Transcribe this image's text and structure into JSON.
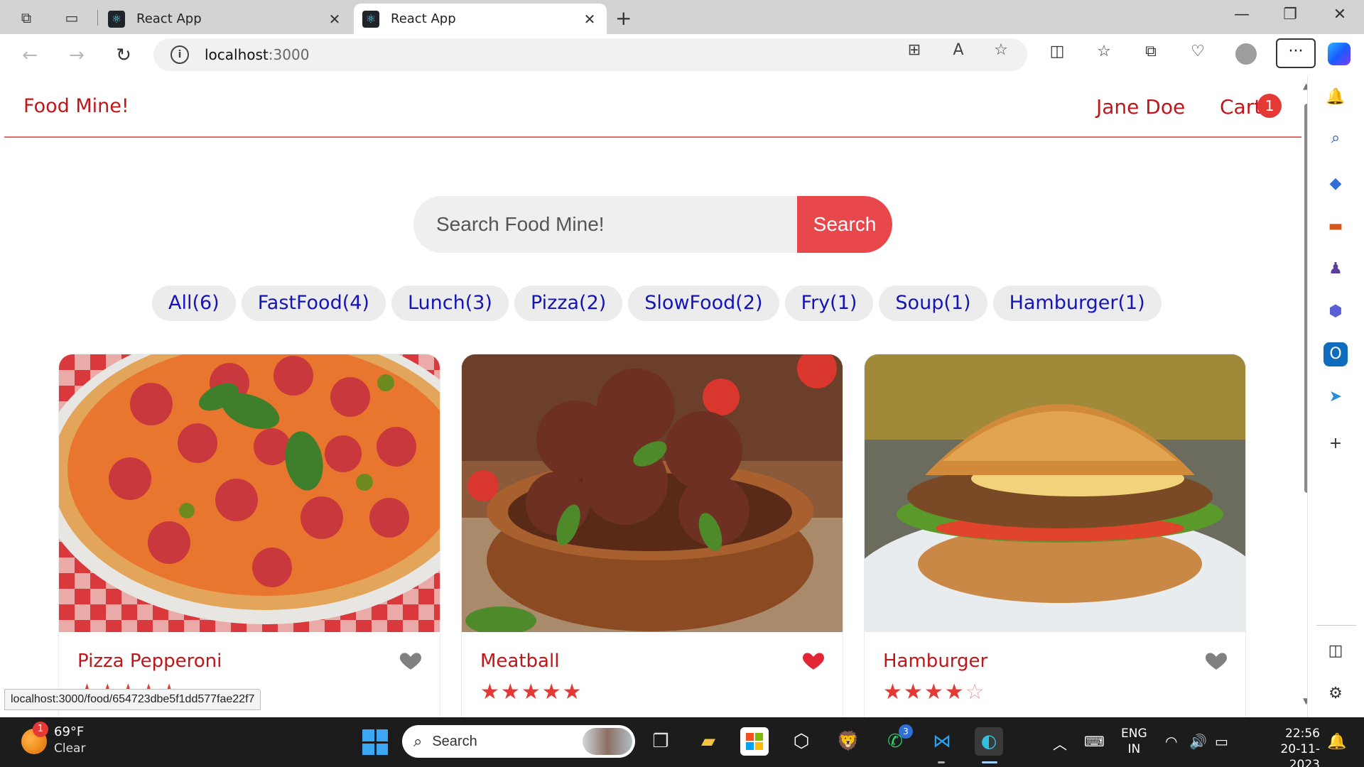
{
  "browser": {
    "tabs": [
      {
        "title": "React App",
        "active": false
      },
      {
        "title": "React App",
        "active": true
      }
    ],
    "url_host": "localhost",
    "url_port": ":3000",
    "status_url": "localhost:3000/food/654723dbe5f1dd577fae22f7"
  },
  "app": {
    "brand": "Food Mine!",
    "user_name": "Jane Doe",
    "cart_label": "Cart",
    "cart_count": "1",
    "search_placeholder": "Search Food Mine!",
    "search_button": "Search",
    "tags": [
      "All(6)",
      "FastFood(4)",
      "Lunch(3)",
      "Pizza(2)",
      "SlowFood(2)",
      "Fry(1)",
      "Soup(1)",
      "Hamburger(1)"
    ],
    "foods": [
      {
        "name": "Pizza Pepperoni",
        "favorite": false,
        "stars": 4.5
      },
      {
        "name": "Meatball",
        "favorite": true,
        "stars": 5
      },
      {
        "name": "Hamburger",
        "favorite": false,
        "stars": 3.5
      }
    ]
  },
  "colors": {
    "brand_red": "#c0161a",
    "search_button": "#e8484c",
    "tag_text": "#1414b8",
    "star": "#e53935",
    "heart_favorite": "#e32636",
    "heart_default": "#808080"
  },
  "taskbar": {
    "weather_badge": "1",
    "temperature": "69°F",
    "condition": "Clear",
    "search_label": "Search",
    "whatsapp_badge": "3",
    "lang_line1": "ENG",
    "lang_line2": "IN",
    "time": "22:56",
    "date": "20-11-2023"
  }
}
